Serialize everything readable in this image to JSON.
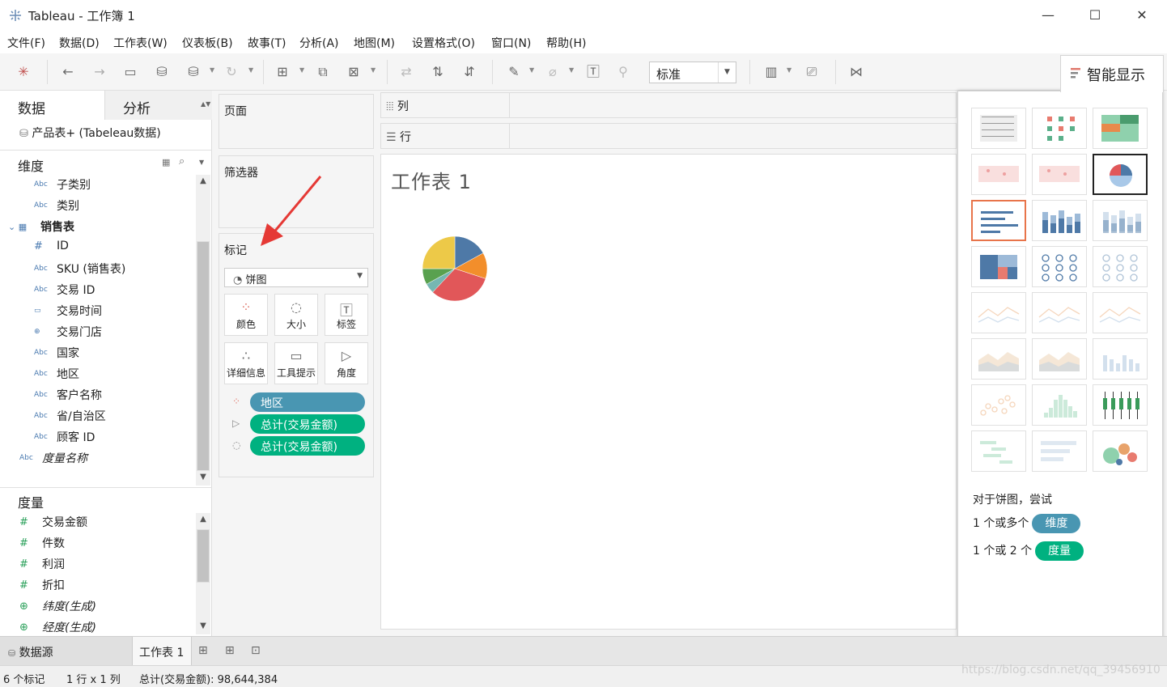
{
  "window": {
    "title": "Tableau - 工作簿 1"
  },
  "menu": [
    "文件(F)",
    "数据(D)",
    "工作表(W)",
    "仪表板(B)",
    "故事(T)",
    "分析(A)",
    "地图(M)",
    "设置格式(O)",
    "窗口(N)",
    "帮助(H)"
  ],
  "toolbar": {
    "fit_select": "标准"
  },
  "showme": {
    "label": "智能显示",
    "hint_title": "对于饼图，尝试",
    "line1_prefix": "1 个或多个",
    "line1_pill": "维度",
    "line2_prefix": "1 个或 2 个",
    "line2_pill": "度量"
  },
  "datapane": {
    "tab_data": "数据",
    "tab_analysis": "分析",
    "source": "产品表+ (Tabeleau数据)",
    "dimensions_title": "维度",
    "dimensions": [
      {
        "icon": "Abc",
        "label": "子类别"
      },
      {
        "icon": "Abc",
        "label": "类别"
      },
      {
        "icon": "table",
        "label": "销售表"
      },
      {
        "icon": "#",
        "label": "ID"
      },
      {
        "icon": "Abc",
        "label": "SKU (销售表)"
      },
      {
        "icon": "Abc",
        "label": "交易 ID"
      },
      {
        "icon": "date",
        "label": "交易时间"
      },
      {
        "icon": "globe",
        "label": "交易门店"
      },
      {
        "icon": "Abc",
        "label": "国家"
      },
      {
        "icon": "Abc",
        "label": "地区"
      },
      {
        "icon": "Abc",
        "label": "客户名称"
      },
      {
        "icon": "Abc",
        "label": "省/自治区"
      },
      {
        "icon": "Abc",
        "label": "顾客 ID"
      },
      {
        "icon": "Abc",
        "label": "度量名称"
      }
    ],
    "measures_title": "度量",
    "measures": [
      {
        "icon": "#",
        "label": "交易金额"
      },
      {
        "icon": "#",
        "label": "件数"
      },
      {
        "icon": "#",
        "label": "利润"
      },
      {
        "icon": "#",
        "label": "折扣"
      },
      {
        "icon": "globe",
        "label": "纬度(生成)"
      },
      {
        "icon": "globe",
        "label": "经度(生成)"
      }
    ]
  },
  "shelves": {
    "pages": "页面",
    "filters": "筛选器",
    "columns": "列",
    "rows": "行"
  },
  "marks": {
    "title": "标记",
    "type": "饼图",
    "buttons": [
      "颜色",
      "大小",
      "标签",
      "详细信息",
      "工具提示",
      "角度"
    ],
    "pills": [
      {
        "kind": "color",
        "label": "地区"
      },
      {
        "kind": "angle",
        "label": "总计(交易金额)"
      },
      {
        "kind": "size",
        "label": "总计(交易金额)"
      }
    ]
  },
  "viz": {
    "title": "工作表 1",
    "chart_data": {
      "type": "pie",
      "slices": [
        {
          "color": "#4e79a7",
          "value": 0.17
        },
        {
          "color": "#f28e2b",
          "value": 0.13
        },
        {
          "color": "#e15759",
          "value": 0.32
        },
        {
          "color": "#76b7b2",
          "value": 0.05
        },
        {
          "color": "#59a14f",
          "value": 0.08
        },
        {
          "color": "#edc948",
          "value": 0.25
        }
      ]
    }
  },
  "sheetbar": {
    "datasource": "数据源",
    "sheet": "工作表 1"
  },
  "status": {
    "marks": "6 个标记",
    "dims": "1 行 x 1 列",
    "sum": "总计(交易金额): 98,644,384"
  },
  "watermark": "https://blog.csdn.net/qq_39456910"
}
